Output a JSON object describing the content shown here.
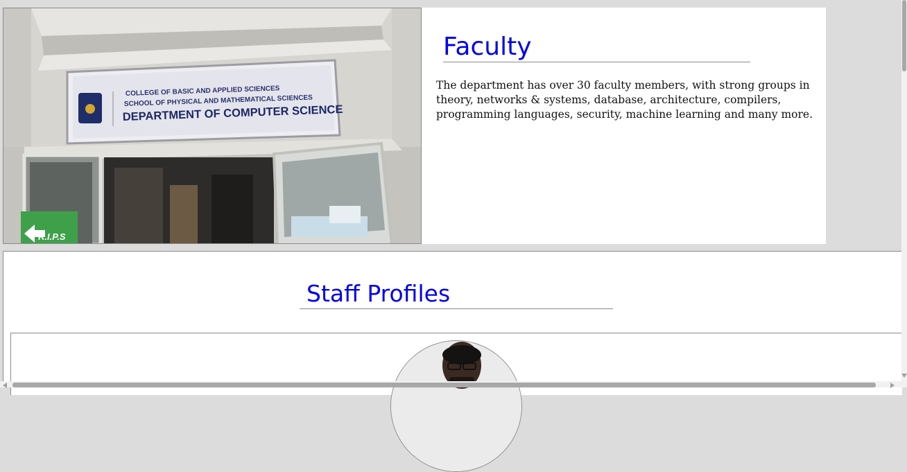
{
  "faculty": {
    "title": "Faculty",
    "description": "The department has over 30 faculty members, with strong groups in theory, networks & systems, database, architecture, compilers, programming languages, security, machine learning and many more.",
    "photo": {
      "sign_line1": "COLLEGE OF BASIC AND APPLIED SCIENCES",
      "sign_line2": "SCHOOL OF PHYSICAL AND MATHEMATICAL SCIENCES",
      "sign_line3": "DEPARTMENT OF COMPUTER SCIENCE",
      "green_sign": "R.I.P.S"
    }
  },
  "staff": {
    "title": "Staff Profiles"
  },
  "colors": {
    "heading": "#0000ee",
    "page_bg": "#dcdcdc"
  }
}
